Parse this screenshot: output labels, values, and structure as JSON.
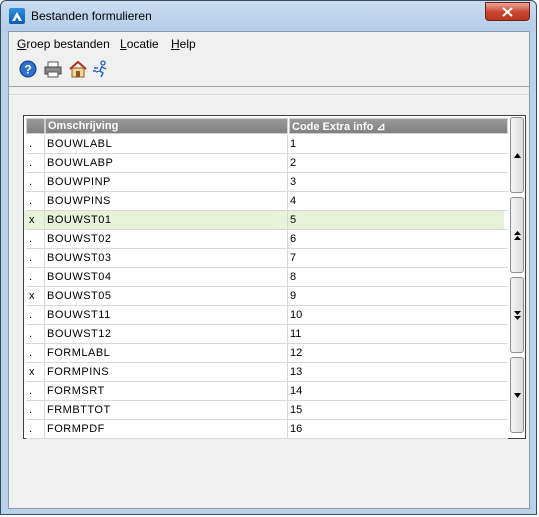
{
  "window": {
    "title": "Bestanden formulieren"
  },
  "menu": [
    {
      "label": "Groep bestanden",
      "underline": "G",
      "rest": "roep bestanden"
    },
    {
      "label": "Locatie",
      "underline": "L",
      "rest": "ocatie"
    },
    {
      "label": "Help",
      "underline": "H",
      "rest": "elp"
    }
  ],
  "toolbar": {
    "icons": [
      "help-icon",
      "print-icon",
      "home-icon",
      "run-icon"
    ]
  },
  "grid": {
    "columns": [
      "",
      "Omschrijving",
      "Code  Extra info  ⊿"
    ],
    "rows": [
      {
        "mark": ".",
        "name": "BOUWLABL",
        "code": "1"
      },
      {
        "mark": ".",
        "name": "BOUWLABP",
        "code": "2"
      },
      {
        "mark": ".",
        "name": "BOUWPINP",
        "code": "3"
      },
      {
        "mark": ".",
        "name": "BOUWPINS",
        "code": "4"
      },
      {
        "mark": "x",
        "name": "BOUWST01",
        "code": "5"
      },
      {
        "mark": ".",
        "name": "BOUWST02",
        "code": "6"
      },
      {
        "mark": ".",
        "name": "BOUWST03",
        "code": "7"
      },
      {
        "mark": ".",
        "name": "BOUWST04",
        "code": "8"
      },
      {
        "mark": "x",
        "name": "BOUWST05",
        "code": "9"
      },
      {
        "mark": ".",
        "name": "BOUWST11",
        "code": "10"
      },
      {
        "mark": ".",
        "name": "BOUWST12",
        "code": "11"
      },
      {
        "mark": ".",
        "name": "FORMLABL",
        "code": "12"
      },
      {
        "mark": "x",
        "name": "FORMPINS",
        "code": "13"
      },
      {
        "mark": ".",
        "name": "FORMSRT",
        "code": "14"
      },
      {
        "mark": ".",
        "name": "FRMBTTOT",
        "code": "15"
      },
      {
        "mark": ".",
        "name": "FORMPDF",
        "code": "16"
      }
    ],
    "selected_row": 4,
    "colors": {
      "selected": "#e8f2d8",
      "header": "#808080"
    }
  }
}
